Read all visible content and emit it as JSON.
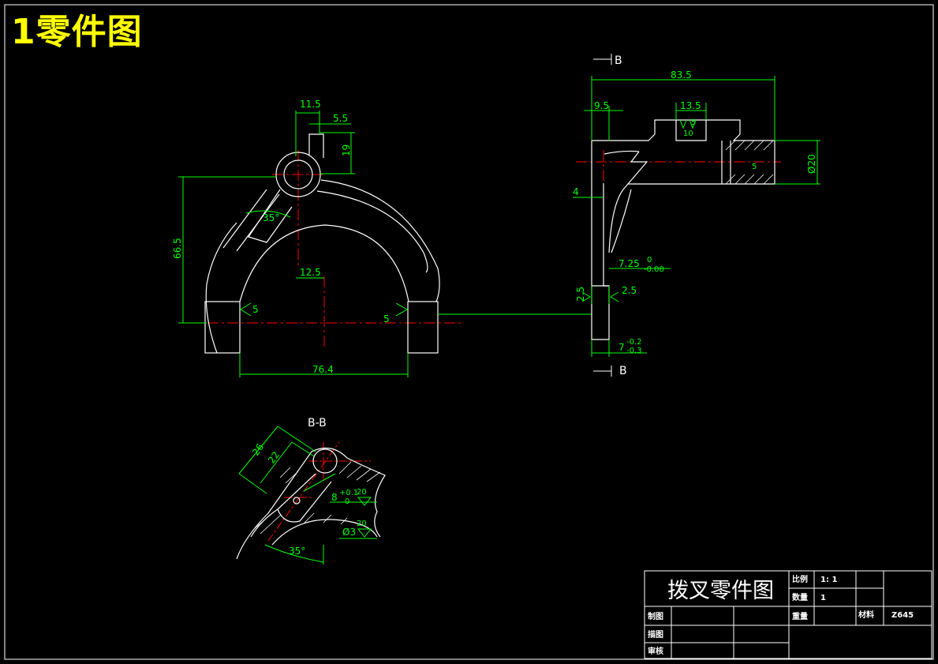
{
  "heading": "1零件图",
  "main_view": {
    "dims": {
      "d11_5": "11.5",
      "d5_5": "5.5",
      "d19": "19",
      "d66_5": "66.5",
      "d35deg": "35°",
      "d12_5": "12.5",
      "d76_4": "76.4",
      "rough_left": "5",
      "rough_right": "5"
    }
  },
  "side_view": {
    "section_mark": "B",
    "dims": {
      "d83_5": "83.5",
      "d9_5": "9.5",
      "d13_5": "13.5",
      "rough_top": "5",
      "rough_top2": "10",
      "d20": "Ø20",
      "d4": "4",
      "d7_25": "7.25",
      "tol_0": "0",
      "tol_m008": "-0.08",
      "d2_5_left": "2.5",
      "d2_5_right": "2.5",
      "d7": "7",
      "tol_m02": "-0.2",
      "tol_m03": "-0.3",
      "rough_bore": "5"
    }
  },
  "section_view": {
    "label": "B-B",
    "dims": {
      "d26": "26",
      "d22": "22",
      "d8": "8",
      "tol_p01": "+0.1",
      "tol_0b": "0",
      "rough20a": "20",
      "rough20b": "20",
      "d_phi3": "Ø3",
      "d35deg": "35°"
    }
  },
  "title_block": {
    "title": "拨叉零件图",
    "scale_label": "比例",
    "scale_value": "1: 1",
    "qty_label": "数量",
    "qty_value": "1",
    "weight_label": "重量",
    "material_label": "材料",
    "material_value": "Z645",
    "drawn_label": "制图",
    "traced_label": "描图",
    "checked_label": "审核"
  },
  "colors": {
    "background": "#000000",
    "outline": "#ffffff",
    "dimension": "#00ff00",
    "centerline": "#ff0000",
    "heading": "#ffff00"
  }
}
